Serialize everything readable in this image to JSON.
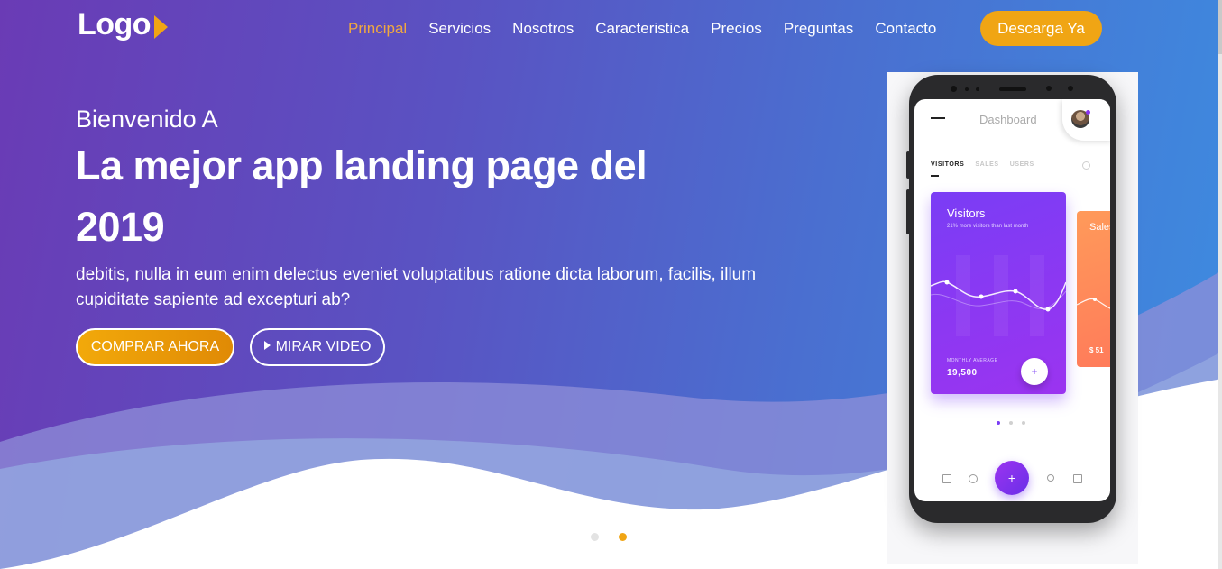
{
  "brand": {
    "logo": "Logo",
    "accent": "#f0a514"
  },
  "nav": {
    "links": [
      "Principal",
      "Servicios",
      "Nosotros",
      "Caracteristica",
      "Precios",
      "Preguntas",
      "Contacto"
    ],
    "active_index": 0,
    "cta": "Descarga Ya"
  },
  "hero": {
    "greeting": "Bienvenido A",
    "headline": "La mejor app landing page del 2019",
    "subtext": "debitis, nulla in eum enim delectus eveniet voluptatibus ratione dicta laborum, facilis, illum cupiditate sapiente ad excepturi ab?",
    "buy_button": "COMPRAR AHORA",
    "video_button": "MIRAR VIDEO"
  },
  "slider": {
    "count": 2,
    "active_index": 1
  },
  "phone_app": {
    "title": "Dashboard",
    "tabs": [
      "VISITORS",
      "SALES",
      "USERS"
    ],
    "active_tab": 0,
    "visitors_card": {
      "title": "Visitors",
      "subtitle": "21% more visitors than last month",
      "avg_label": "MONTHLY AVERAGE",
      "avg_value": "19,500",
      "plus": "+"
    },
    "sales_card": {
      "title": "Sales",
      "amount": "$ 51"
    },
    "fab": "+"
  }
}
